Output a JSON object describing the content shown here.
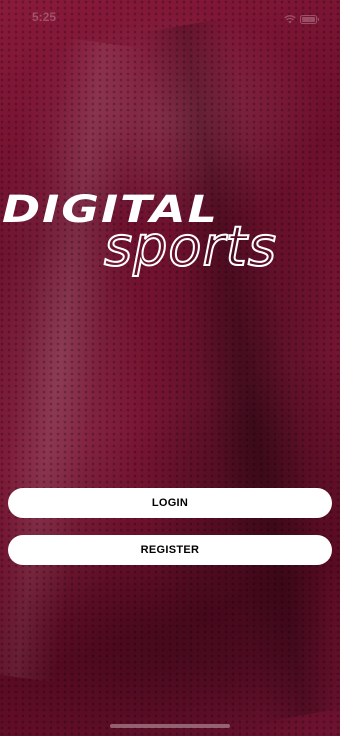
{
  "status_bar": {
    "time": "5:25",
    "icons": [
      "wifi-icon",
      "battery-icon"
    ]
  },
  "logo": {
    "line1": "DIGITAL",
    "line2": "sports"
  },
  "actions": {
    "login_label": "LOGIN",
    "register_label": "REGISTER"
  },
  "colors": {
    "background": "#6c0f2c",
    "button": "#ffffff",
    "button_text": "#000000"
  }
}
